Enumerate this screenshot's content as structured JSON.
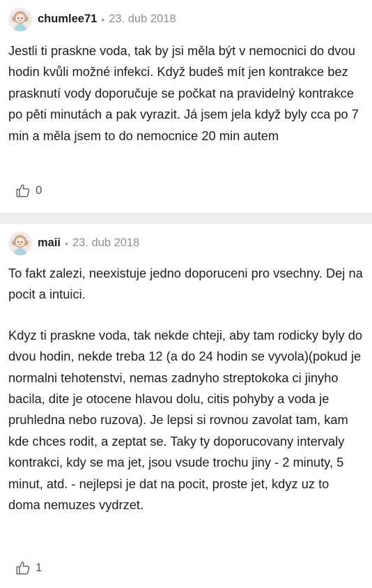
{
  "comments": [
    {
      "author": "chumlee71",
      "separator": "•",
      "date": "23. dub 2018",
      "paragraphs": [
        "Jestli ti praskne voda, tak by jsi měla být v nemocnici do dvou hodin kvůli možné infekci. Když budeš mít jen kontrakce bez prasknutí vody doporučuje se počkat na pravidelný kontrakce po pěti minutách a pak vyrazit. Já jsem jela když byly cca po 7 min a měla jsem to do nemocnice 20 min autem"
      ],
      "likes": "0"
    },
    {
      "author": "maii",
      "separator": "•",
      "date": "23. dub 2018",
      "paragraphs": [
        "To fakt zalezi, neexistuje jedno doporuceni pro vsechny. Dej na pocit a intuici.",
        "Kdyz ti praskne voda, tak nekde chteji, aby tam rodicky byly do dvou hodin, nekde treba 12 (a do 24 hodin se vyvola)(pokud je normalni tehotenstvi, nemas zadnyho streptokoka ci jinyho bacila, dite je otocene hlavou dolu, citis pohyby a voda je pruhledna nebo ruzova). Je lepsi si rovnou zavolat tam, kam kde chces rodit, a zeptat se. Taky ty doporucovany intervaly kontrakci, kdy se ma jet, jsou vsude trochu jiny - 2 minuty, 5 minut, atd. - nejlepsi je dat na pocit, proste jet, kdyz uz to doma nemuzes vydrzet."
      ],
      "likes": "1"
    }
  ],
  "icons": {
    "avatar": "avatar-icon",
    "like": "thumbs-up-icon"
  },
  "colors": {
    "divider": "#eeeeee",
    "avatar_bg": "#f3e7e7",
    "avatar_hair": "#c9a98f",
    "avatar_dress": "#a9d5dd"
  }
}
